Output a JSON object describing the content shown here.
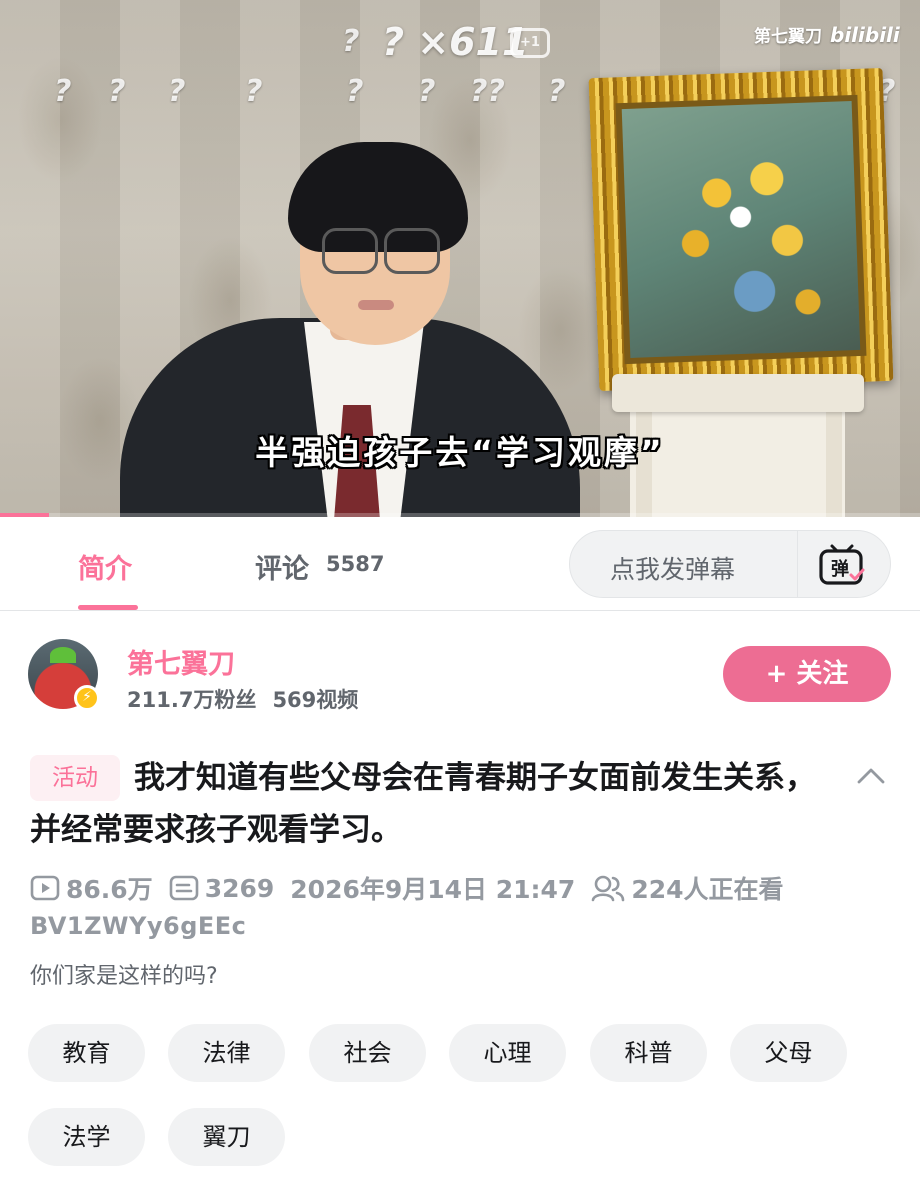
{
  "video": {
    "combo_text": "? ×611",
    "watermark_name": "第七翼刀",
    "watermark_logo": "bilibili",
    "subtitle": "半强迫孩子去“学习观摩”",
    "progress_fraction": 0.053
  },
  "tabs": {
    "intro_label": "简介",
    "comments_label": "评论",
    "comments_count": "5587",
    "danmaku_placeholder": "点我发弹幕",
    "danmaku_icon_glyph": "弹"
  },
  "author": {
    "name": "第七翼刀",
    "fans": "211.7万粉丝",
    "videos": "569视频",
    "follow_label": "+ 关注"
  },
  "video_info": {
    "activity_tag": "活动",
    "title": "我才知道有些父母会在青春期子女面前发生关系，并经常要求孩子观看学习。",
    "views": "86.6万",
    "danmaku_count": "3269",
    "publish_time": "2026年9月14日 21:47",
    "watching": "224人正在看",
    "bvid": "BV1ZWYy6gEEc",
    "description": "你们家是这样的吗?"
  },
  "tags": [
    "教育",
    "法律",
    "社会",
    "心理",
    "科普",
    "父母",
    "法学",
    "翼刀"
  ],
  "colors": {
    "accent": "#fb7299",
    "follow_button": "#ed6d93",
    "meta_gray": "#9499a0"
  }
}
